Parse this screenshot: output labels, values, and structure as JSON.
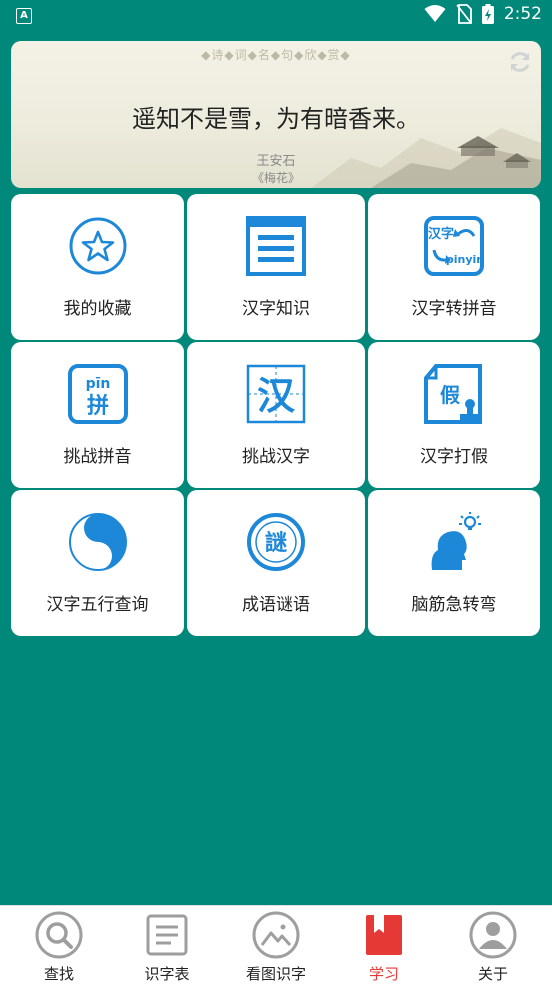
{
  "status_bar": {
    "time": "2:52",
    "app_icon_letter": "A"
  },
  "banner": {
    "header": "◆诗◆词◆名◆句◆欣◆赏◆",
    "verse": "遥知不是雪，为有暗香来。",
    "author": "王安石",
    "title": "《梅花》",
    "refresh_icon": "refresh-icon"
  },
  "tiles": [
    {
      "label": "我的收藏",
      "icon": "star-circle-icon"
    },
    {
      "label": "汉字知识",
      "icon": "document-icon"
    },
    {
      "label": "汉字转拼音",
      "icon": "hanzi-pinyin-icon"
    },
    {
      "label": "挑战拼音",
      "icon": "pin-card-icon"
    },
    {
      "label": "挑战汉字",
      "icon": "han-character-icon"
    },
    {
      "label": "汉字打假",
      "icon": "jia-stamp-icon"
    },
    {
      "label": "汉字五行查询",
      "icon": "yin-yang-icon"
    },
    {
      "label": "成语谜语",
      "icon": "riddle-seal-icon"
    },
    {
      "label": "脑筋急转弯",
      "icon": "brain-idea-icon"
    }
  ],
  "tile_icon_text": {
    "hanzi": "汉字",
    "pinyin": "pinyin",
    "pin_top": "pīn",
    "pin_char": "拼",
    "han": "汉",
    "jia": "假",
    "mi": "謎"
  },
  "bottom_nav": [
    {
      "label": "查找",
      "icon": "search-icon",
      "active": false
    },
    {
      "label": "识字表",
      "icon": "list-icon",
      "active": false
    },
    {
      "label": "看图识字",
      "icon": "image-icon",
      "active": false
    },
    {
      "label": "学习",
      "icon": "bookmark-book-icon",
      "active": true
    },
    {
      "label": "关于",
      "icon": "user-icon",
      "active": false
    }
  ],
  "colors": {
    "background": "#00897b",
    "icon_blue": "#1e88d8",
    "active_red": "#e53935",
    "nav_gray": "#9e9e9e"
  }
}
